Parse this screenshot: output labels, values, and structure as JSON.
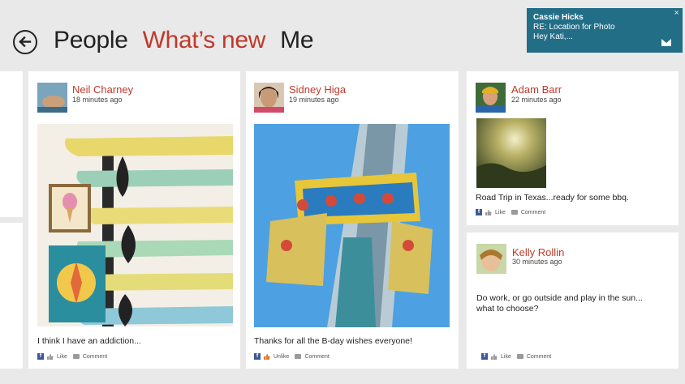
{
  "header": {
    "nav": [
      "People",
      "What’s new",
      "Me"
    ],
    "active_index": 1
  },
  "notification": {
    "sender": "Cassie Hicks",
    "subject": "RE: Location for Photo",
    "preview": "Hey Kati,...",
    "close_glyph": "×",
    "icon": "mail-icon"
  },
  "posts": [
    {
      "name": "Neil Charney",
      "time": "18 minutes ago",
      "text": "I think I have an addiction...",
      "actions": {
        "like": "Like",
        "comment": "Comment"
      }
    },
    {
      "name": "Sidney Higa",
      "time": "19 minutes ago",
      "text": "Thanks for all the B-day wishes everyone!",
      "actions": {
        "like": "Unlike",
        "comment": "Comment"
      }
    },
    {
      "name": "Adam Barr",
      "time": "22 minutes ago",
      "text": "Road Trip in Texas...ready for some bbq.",
      "actions": {
        "like": "Like",
        "comment": "Comment"
      }
    },
    {
      "name": "Kelly Rollin",
      "time": "30 minutes ago",
      "text": "Do work, or go outside and play in the sun... what to choose?",
      "actions": {
        "like": "Like",
        "comment": "Comment"
      }
    }
  ],
  "colors": {
    "accent": "#c0392b",
    "toast": "#226e87",
    "facebook": "#3b5998"
  }
}
